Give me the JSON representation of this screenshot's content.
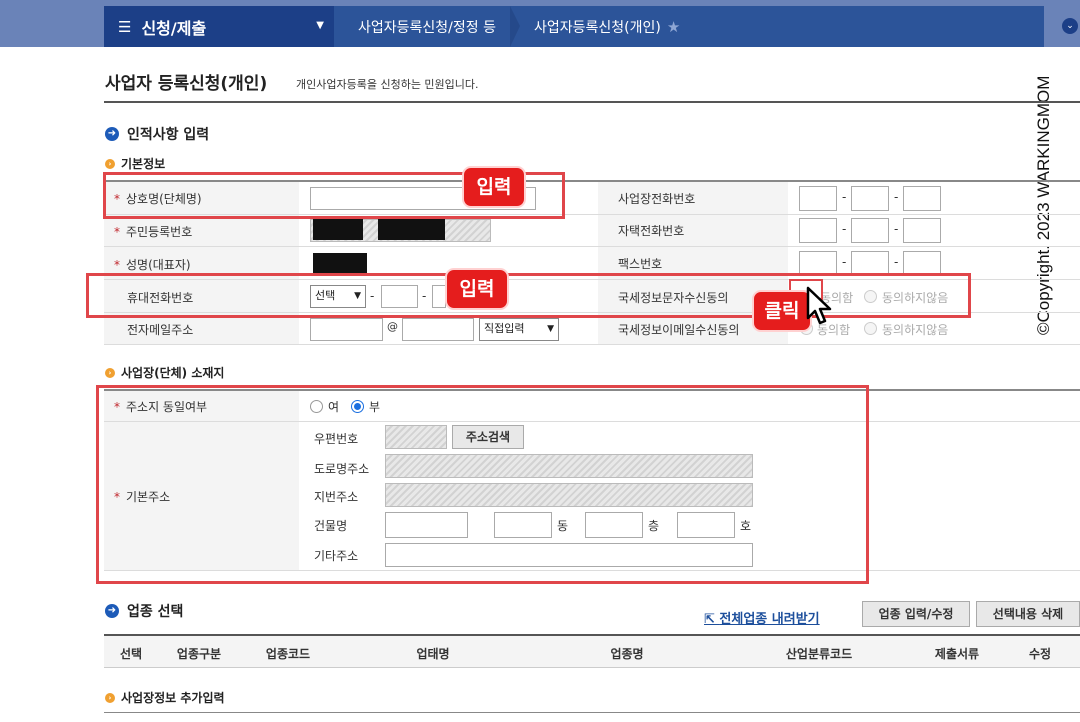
{
  "nav": {
    "menu_title": "신청/제출",
    "crumbs": [
      "사업자등록신청/정정 등",
      "사업자등록신청(개인)"
    ]
  },
  "watermark": "©Copyright. 2023 WARKINGMOM",
  "page": {
    "title": "사업자 등록신청(개인)",
    "subtitle": "개인사업자등록을 신청하는 민원입니다."
  },
  "sections": {
    "personal": "인적사항 입력",
    "basic": "기본정보",
    "location": "사업장(단체) 소재지",
    "industry": "업종 선택",
    "extra": "사업장정보 추가입력"
  },
  "form": {
    "trade_name_label": "상호명(단체명)",
    "rrn_label": "주민등록번호",
    "name_label": "성명(대표자)",
    "mobile_label": "휴대전화번호",
    "email_label": "전자메일주소",
    "biz_phone_label": "사업장전화번호",
    "home_phone_label": "자택전화번호",
    "fax_label": "팩스번호",
    "sms_consent_label": "국세정보문자수신동의",
    "email_consent_label": "국세정보이메일수신동의",
    "agree": "동의함",
    "disagree": "동의하지않음",
    "mobile_select": "선택",
    "email_at": "@",
    "email_domain_select": "직접입력",
    "dash": "-"
  },
  "address": {
    "same_label": "주소지 동일여부",
    "yes": "여",
    "no": "부",
    "base_label": "기본주소",
    "zip_label": "우편번호",
    "search_button": "주소검색",
    "road_label": "도로명주소",
    "lot_label": "지번주소",
    "building_label": "건물명",
    "dong": "동",
    "floor": "층",
    "ho": "호",
    "other_label": "기타주소"
  },
  "annotations": {
    "input1": "입력",
    "input2": "입력",
    "click": "클릭"
  },
  "industry": {
    "download_link": "전체업종 내려받기",
    "input_button": "업종 입력/수정",
    "delete_button": "선택내용 삭제",
    "columns": [
      "선택",
      "업종구분",
      "업종코드",
      "업태명",
      "업종명",
      "산업분류코드",
      "제출서류",
      "수정"
    ]
  }
}
